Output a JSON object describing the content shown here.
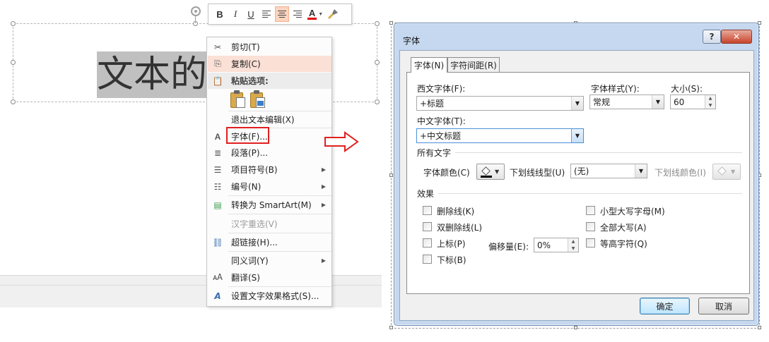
{
  "slide": {
    "text": "文本的"
  },
  "mini_toolbar": {
    "bold": "B",
    "italic": "I",
    "underline": "U",
    "font_color": "A"
  },
  "context_menu": {
    "cut": "剪切(T)",
    "copy": "复制(C)",
    "paste_options": "粘贴选项:",
    "exit_edit": "退出文本编辑(X)",
    "font": "字体(F)...",
    "paragraph": "段落(P)...",
    "bullets": "项目符号(B)",
    "numbering": "编号(N)",
    "smartart": "转换为 SmartArt(M)",
    "reconversion": "汉字重选(V)",
    "hyperlink": "超链接(H)...",
    "synonyms": "同义词(Y)",
    "translate": "翻译(S)",
    "format_text_effects": "设置文字效果格式(S)..."
  },
  "dialog": {
    "title": "字体",
    "help": "?",
    "close": "✕",
    "tabs": [
      "字体(N)",
      "字符间距(R)"
    ],
    "latin_font_label": "西文字体(F):",
    "latin_font_value": "+标题",
    "font_style_label": "字体样式(Y):",
    "font_style_value": "常规",
    "size_label": "大小(S):",
    "size_value": "60",
    "asian_font_label": "中文字体(T):",
    "asian_font_value": "+中文标题",
    "all_text_group": "所有文字",
    "font_color_label": "字体颜色(C)",
    "underline_style_label": "下划线线型(U)",
    "underline_style_value": "(无)",
    "underline_color_label": "下划线颜色(I)",
    "effects_group": "效果",
    "strikethrough": "删除线(K)",
    "double_strikethrough": "双删除线(L)",
    "superscript": "上标(P)",
    "subscript": "下标(B)",
    "offset_label": "偏移量(E):",
    "offset_value": "0%",
    "small_caps": "小型大写字母(M)",
    "all_caps": "全部大写(A)",
    "equalize_height": "等高字符(Q)",
    "ok": "确定",
    "cancel": "取消"
  },
  "colors": {
    "highlight_red": "#e02020",
    "menu_hover": "#fbe0d6",
    "dialog_frame": "#c5d8ef"
  }
}
